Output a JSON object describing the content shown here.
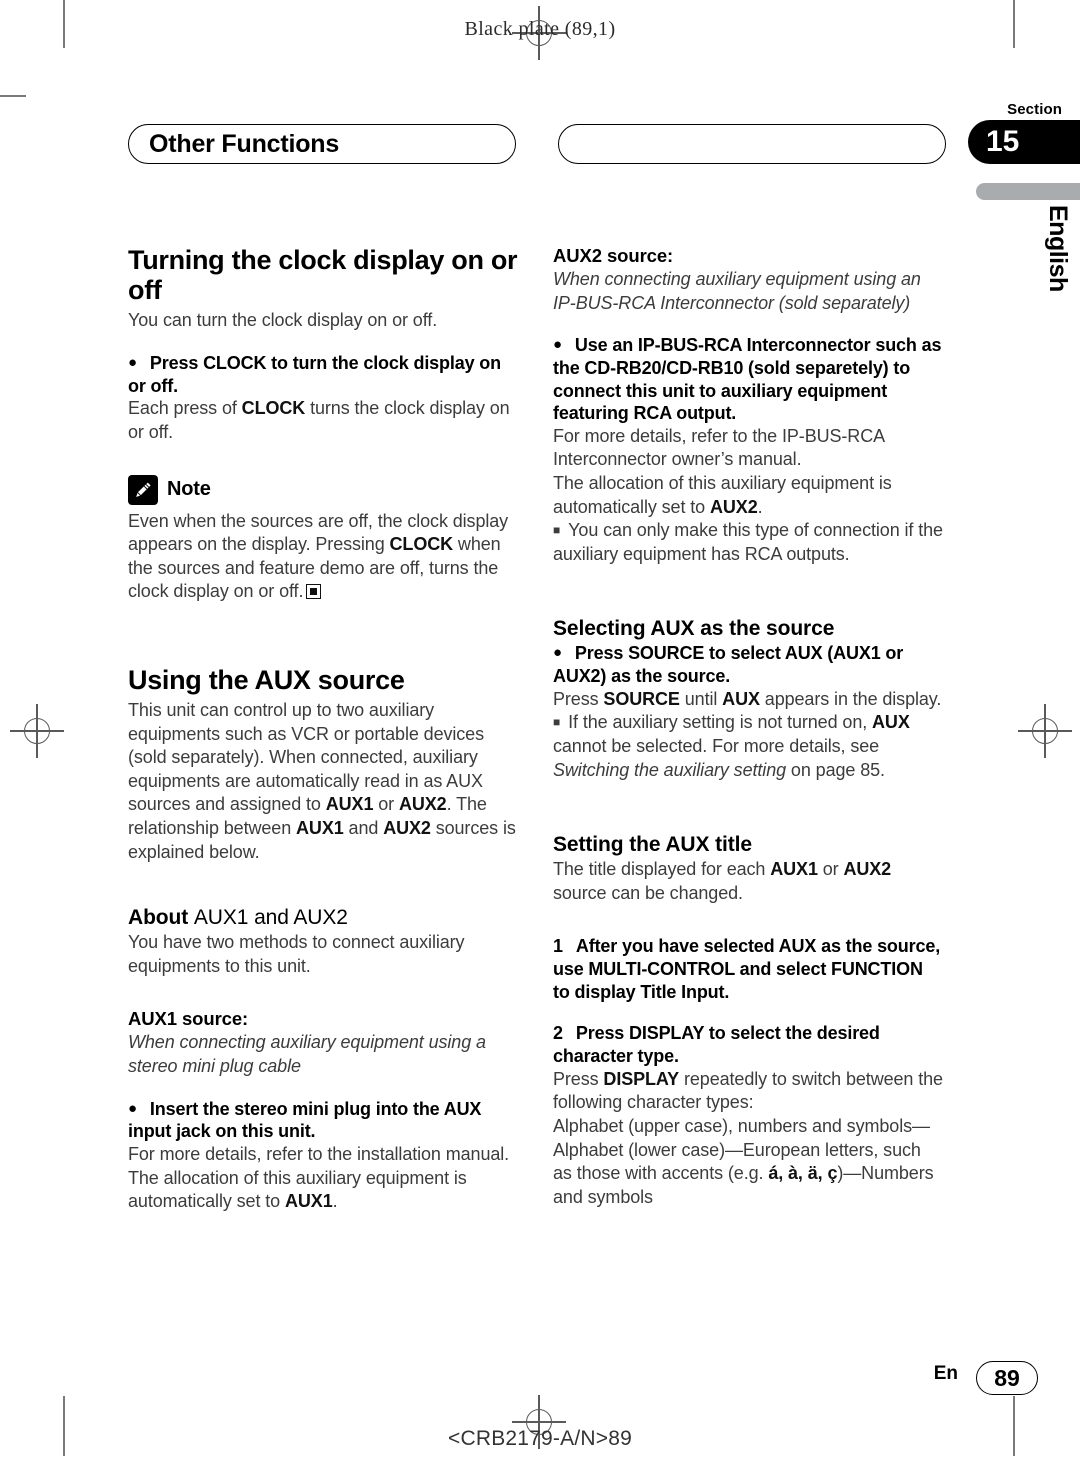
{
  "page": {
    "plate_note": "Black plate (89,1)",
    "section_word": "Section",
    "section_number": "15",
    "language_tab": "English",
    "footer_lang": "En",
    "footer_page": "89",
    "footer_code": "<CRB2179-A/N>89"
  },
  "chapter": {
    "title": "Other Functions"
  },
  "left": {
    "clock": {
      "heading": "Turning the clock display on or off",
      "intro": "You can turn the clock display on or off.",
      "instruction_bullet": "●",
      "instruction": "Press CLOCK to turn the clock display on or off.",
      "detail_pre": "Each press of ",
      "detail_bold": "CLOCK",
      "detail_post": " turns the clock display on or off."
    },
    "note": {
      "label": "Note",
      "icon": "pencil-icon",
      "text_a": "Even when the sources are off, the clock display appears on the display. Pressing ",
      "text_bold": "CLOCK",
      "text_b": " when the sources and feature demo are off, turns the clock display on or off."
    },
    "aux": {
      "heading": "Using the AUX source",
      "para_a": "This unit can control up to two auxiliary equipments such as VCR or portable devices (sold separately). When connected, auxiliary equipments are automatically read in as AUX sources and assigned to ",
      "b1": "AUX1",
      "mid1": " or ",
      "b2": "AUX2",
      "mid2": ". The relationship between ",
      "b3": "AUX1",
      "mid3": " and ",
      "b4": "AUX2",
      "para_end": " sources is explained below."
    },
    "about": {
      "heading_bold": "About ",
      "heading_reg": "AUX1 and AUX2",
      "intro": "You have two methods to connect auxiliary equipments to this unit.",
      "aux1_label_bold": "AUX1",
      "aux1_label_rest": " source:",
      "aux1_italic": "When connecting auxiliary equipment using a stereo mini plug cable",
      "bullet": "●",
      "instruction": "Insert the stereo mini plug into the AUX input jack on this unit.",
      "detail_a": "For more details, refer to the installation manual.",
      "detail_b": "The allocation of this auxiliary equipment is automatically set to ",
      "detail_bold": "AUX1",
      "detail_end": "."
    }
  },
  "right": {
    "aux2": {
      "label_bold": "AUX2",
      "label_rest": " source:",
      "italic": "When connecting auxiliary equipment using an IP-BUS-RCA Interconnector (sold separately)",
      "bullet": "●",
      "instruction": "Use an IP-BUS-RCA Interconnector such as the CD-RB20/CD-RB10 (sold separetely) to connect this unit to auxiliary equipment featuring RCA output.",
      "detail_a": "For more details, refer to the IP-BUS-RCA Interconnector owner’s manual.",
      "detail_b": "The allocation of this auxiliary equipment is automatically set to ",
      "detail_bold": "AUX2",
      "detail_end": ".",
      "sub_bullet": "■",
      "sub_note": "You can only make this type of connection if the auxiliary equipment has RCA outputs."
    },
    "selecting": {
      "heading": "Selecting AUX as the source",
      "bullet": "●",
      "instruction": "Press SOURCE to select AUX (AUX1 or AUX2) as the source.",
      "detail_a": "Press ",
      "detail_b1": "SOURCE",
      "detail_b_mid": " until ",
      "detail_b2": "AUX",
      "detail_end": " appears in the display.",
      "sub_bullet": "■",
      "sub_a": "If the auxiliary setting is not turned on, ",
      "sub_b": "AUX",
      "sub_c": " cannot be selected. For more details, see ",
      "sub_italic": "Switching the auxiliary setting",
      "sub_d": " on page 85."
    },
    "title": {
      "heading": "Setting the AUX title",
      "intro_a": "The title displayed for each ",
      "intro_b1": "AUX1",
      "intro_mid": " or ",
      "intro_b2": "AUX2",
      "intro_end": " source can be changed.",
      "step1_num": "1",
      "step1": "After you have selected AUX as the source, use MULTI-CONTROL and select FUNCTION to display Title Input.",
      "step2_num": "2",
      "step2": "Press DISPLAY to select the desired character type.",
      "step2_detail_a": "Press ",
      "step2_detail_bold": "DISPLAY",
      "step2_detail_b": " repeatedly to switch between the following character types:",
      "step2_detail_c": "Alphabet (upper case), numbers and symbols—Alphabet (lower case)—European letters, such as those with accents (e.g. ",
      "accents": "á, à, ä, ç",
      "step2_detail_d": ")—Numbers and symbols"
    }
  }
}
